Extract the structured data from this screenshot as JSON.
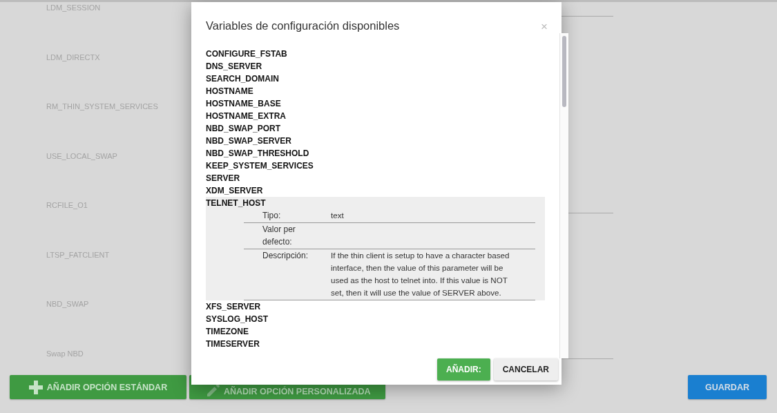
{
  "background": {
    "fields": [
      "LDM_SESSION",
      "LDM_DIRECTX",
      "RM_THIN_SYSTEM_SERVICES",
      "USE_LOCAL_SWAP",
      "RCFILE_O1",
      "LTSP_FATCLIENT",
      "NBD_SWAP",
      "Swap NBD"
    ],
    "buttons": [
      {
        "label": "AÑADIR OPCIÓN ESTÁNDAR",
        "kind": "plus"
      },
      {
        "label": "AÑADIR OPCIÓN PERSONALIZADA",
        "kind": "pencil"
      },
      {
        "label": "GUARDAR",
        "kind": "save"
      }
    ]
  },
  "dialog": {
    "title": "Variables de configuración disponibles",
    "close": "×",
    "variables": [
      {
        "name": "CONFIGURE_FSTAB",
        "expanded": false
      },
      {
        "name": "DNS_SERVER",
        "expanded": false
      },
      {
        "name": "SEARCH_DOMAIN",
        "expanded": false
      },
      {
        "name": "HOSTNAME",
        "expanded": false
      },
      {
        "name": "HOSTNAME_BASE",
        "expanded": false
      },
      {
        "name": "HOSTNAME_EXTRA",
        "expanded": false
      },
      {
        "name": "NBD_SWAP_PORT",
        "expanded": false
      },
      {
        "name": "NBD_SWAP_SERVER",
        "expanded": false
      },
      {
        "name": "NBD_SWAP_THRESHOLD",
        "expanded": false
      },
      {
        "name": "KEEP_SYSTEM_SERVICES",
        "expanded": false
      },
      {
        "name": "SERVER",
        "expanded": false
      },
      {
        "name": "XDM_SERVER",
        "expanded": false
      },
      {
        "name": "TELNET_HOST",
        "expanded": true,
        "details": [
          {
            "label": "Tipo:",
            "value": "text"
          },
          {
            "label": "Valor per defecto:"
          },
          {
            "label": "Descripción:",
            "value": "If the thin client is setup to have a character based interface, then the value of this parameter will be used as the host to telnet into. If this value is NOT set, then it will use the value of SERVER above."
          }
        ]
      },
      {
        "name": "XFS_SERVER",
        "expanded": false
      },
      {
        "name": "SYSLOG_HOST",
        "expanded": false
      },
      {
        "name": "TIMEZONE",
        "expanded": false
      },
      {
        "name": "TIMESERVER",
        "expanded": false
      }
    ],
    "buttons": [
      {
        "label": "AÑADIR:",
        "kind": "primary"
      },
      {
        "label": "CANCELAR",
        "kind": "secondary"
      }
    ]
  }
}
